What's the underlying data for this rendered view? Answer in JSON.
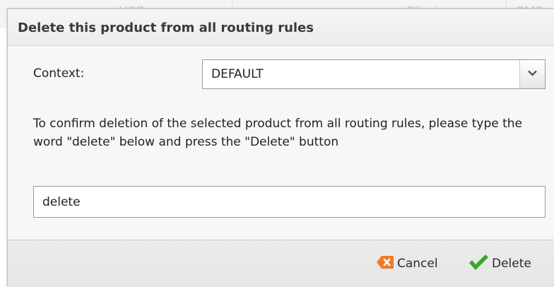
{
  "background": {
    "col_currency": "USD",
    "col_client": "Client",
    "col_sms": "SMS"
  },
  "dialog": {
    "title": "Delete this product from all routing rules",
    "context_label": "Context:",
    "context_value": "DEFAULT",
    "message": "To confirm deletion of the selected product from all routing rules, please type the word \"delete\" below and press the \"Delete\" button",
    "confirm_input_value": "delete",
    "cancel_label": "Cancel",
    "delete_label": "Delete"
  },
  "colors": {
    "cancel_icon": "#f07a2a",
    "delete_icon": "#3aa52b"
  }
}
